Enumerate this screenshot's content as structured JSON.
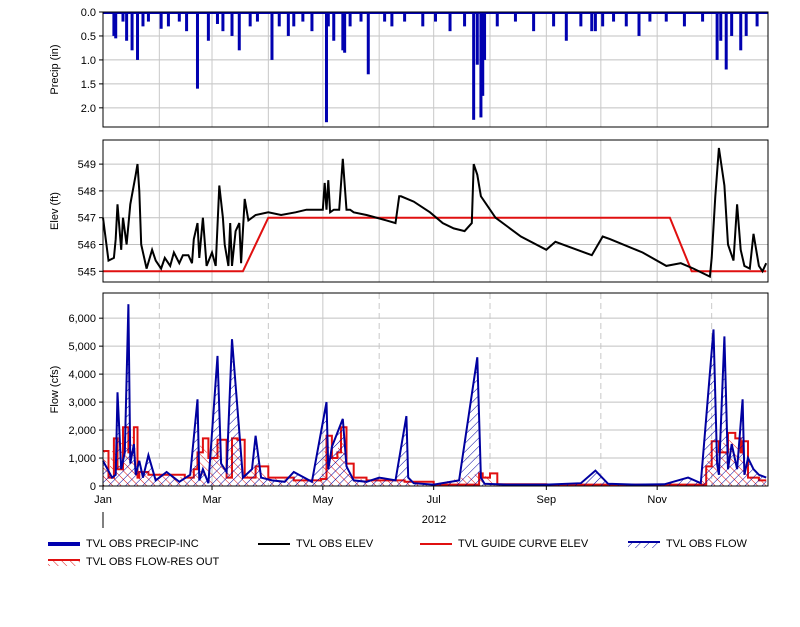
{
  "colors": {
    "precip": "#0000b0",
    "elev": "#000000",
    "guide": "#e01010",
    "flow": "#0000a0",
    "resout": "#e01010",
    "grid": "#c0c0c0",
    "month_grid": "#c8c8c8"
  },
  "x_axis": {
    "year_label": "2012",
    "month_labels": [
      "Jan",
      "Mar",
      "May",
      "Jul",
      "Sep",
      "Nov"
    ],
    "range_days": [
      0,
      366
    ]
  },
  "legend": {
    "items": [
      {
        "label": "TVL OBS PRECIP-INC",
        "icon": "thick-blue-line"
      },
      {
        "label": "TVL OBS ELEV",
        "icon": "black-line"
      },
      {
        "label": "TVL GUIDE CURVE ELEV",
        "icon": "red-line"
      },
      {
        "label": "TVL OBS FLOW",
        "icon": "blue-hatched-area"
      },
      {
        "label": "TVL OBS FLOW-RES OUT",
        "icon": "red-hatched-area"
      }
    ]
  },
  "chart_data": [
    {
      "type": "bar",
      "ylabel": "Precip (in)",
      "ylim": [
        0,
        2.4
      ],
      "y_inverted": true,
      "y_ticks": [
        "0.0",
        "0.5",
        "1.0",
        "1.5",
        "2.0"
      ],
      "series": [
        {
          "name": "TVL OBS PRECIP-INC",
          "x": [
            "2012-01-07",
            "2012-01-08",
            "2012-01-12",
            "2012-01-14",
            "2012-01-17",
            "2012-01-20",
            "2012-01-23",
            "2012-01-26",
            "2012-02-02",
            "2012-02-06",
            "2012-02-12",
            "2012-02-16",
            "2012-02-22",
            "2012-02-28",
            "2012-03-04",
            "2012-03-07",
            "2012-03-12",
            "2012-03-16",
            "2012-03-22",
            "2012-03-26",
            "2012-04-03",
            "2012-04-07",
            "2012-04-12",
            "2012-04-15",
            "2012-04-20",
            "2012-04-25",
            "2012-05-03",
            "2012-05-04",
            "2012-05-07",
            "2012-05-12",
            "2012-05-13",
            "2012-05-16",
            "2012-05-22",
            "2012-05-26",
            "2012-06-04",
            "2012-06-08",
            "2012-06-15",
            "2012-06-25",
            "2012-07-02",
            "2012-07-10",
            "2012-07-18",
            "2012-07-23",
            "2012-07-25",
            "2012-07-27",
            "2012-07-28",
            "2012-07-29",
            "2012-08-05",
            "2012-08-15",
            "2012-08-25",
            "2012-09-05",
            "2012-09-12",
            "2012-09-20",
            "2012-09-26",
            "2012-09-28",
            "2012-10-02",
            "2012-10-08",
            "2012-10-15",
            "2012-10-22",
            "2012-10-28",
            "2012-11-06",
            "2012-11-16",
            "2012-11-26",
            "2012-12-04",
            "2012-12-06",
            "2012-12-09",
            "2012-12-12",
            "2012-12-17",
            "2012-12-20",
            "2012-12-26"
          ],
          "values": [
            0.5,
            0.55,
            0.2,
            0.6,
            0.8,
            1.0,
            0.3,
            0.2,
            0.35,
            0.3,
            0.2,
            0.4,
            1.6,
            0.6,
            0.25,
            0.4,
            0.5,
            0.8,
            0.3,
            0.2,
            1.0,
            0.3,
            0.5,
            0.3,
            0.2,
            0.4,
            2.3,
            0.3,
            0.6,
            0.8,
            0.85,
            0.3,
            0.2,
            1.3,
            0.2,
            0.3,
            0.2,
            0.3,
            0.2,
            0.4,
            0.3,
            2.25,
            1.1,
            2.2,
            1.75,
            1.0,
            0.3,
            0.2,
            0.4,
            0.3,
            0.6,
            0.3,
            0.4,
            0.4,
            0.3,
            0.2,
            0.3,
            0.5,
            0.2,
            0.2,
            0.3,
            0.2,
            1.0,
            0.6,
            1.2,
            0.5,
            0.8,
            0.5,
            0.3
          ]
        }
      ]
    },
    {
      "type": "line",
      "ylabel": "Elev (ft)",
      "ylim": [
        544.6,
        549.9
      ],
      "y_ticks": [
        "545",
        "546",
        "547",
        "548",
        "549"
      ],
      "series": [
        {
          "name": "TVL OBS ELEV",
          "x": [
            "2012-01-01",
            "2012-01-04",
            "2012-01-07",
            "2012-01-08",
            "2012-01-09",
            "2012-01-11",
            "2012-01-12",
            "2012-01-14",
            "2012-01-16",
            "2012-01-19",
            "2012-01-20",
            "2012-01-21",
            "2012-01-22",
            "2012-01-25",
            "2012-01-28",
            "2012-01-30",
            "2012-02-02",
            "2012-02-04",
            "2012-02-07",
            "2012-02-09",
            "2012-02-12",
            "2012-02-14",
            "2012-02-17",
            "2012-02-19",
            "2012-02-20",
            "2012-02-22",
            "2012-02-23",
            "2012-02-25",
            "2012-02-27",
            "2012-03-01",
            "2012-03-03",
            "2012-03-05",
            "2012-03-07",
            "2012-03-08",
            "2012-03-10",
            "2012-03-11",
            "2012-03-12",
            "2012-03-14",
            "2012-03-16",
            "2012-03-17",
            "2012-03-19",
            "2012-03-21",
            "2012-03-25",
            "2012-04-01",
            "2012-04-08",
            "2012-04-16",
            "2012-04-22",
            "2012-05-01",
            "2012-05-02",
            "2012-05-03",
            "2012-05-04",
            "2012-05-05",
            "2012-05-07",
            "2012-05-10",
            "2012-05-12",
            "2012-05-14",
            "2012-05-16",
            "2012-05-18",
            "2012-05-25",
            "2012-06-05",
            "2012-06-10",
            "2012-06-12",
            "2012-06-13",
            "2012-06-20",
            "2012-06-29",
            "2012-07-06",
            "2012-07-12",
            "2012-07-18",
            "2012-07-22",
            "2012-07-23",
            "2012-07-25",
            "2012-07-27",
            "2012-08-04",
            "2012-08-18",
            "2012-09-01",
            "2012-09-06",
            "2012-09-14",
            "2012-09-26",
            "2012-10-02",
            "2012-10-06",
            "2012-10-24",
            "2012-11-06",
            "2012-11-14",
            "2012-11-21",
            "2012-11-30",
            "2012-12-01",
            "2012-12-03",
            "2012-12-05",
            "2012-12-08",
            "2012-12-10",
            "2012-12-13",
            "2012-12-15",
            "2012-12-17",
            "2012-12-19",
            "2012-12-22",
            "2012-12-24",
            "2012-12-27",
            "2012-12-29",
            "2012-12-31"
          ],
          "values": [
            547.0,
            545.4,
            545.5,
            546.2,
            547.5,
            545.8,
            547.0,
            546.0,
            547.5,
            548.6,
            549.0,
            548.0,
            546.0,
            545.1,
            545.8,
            545.4,
            545.1,
            545.5,
            545.2,
            545.7,
            545.3,
            545.6,
            545.6,
            545.3,
            546.2,
            546.8,
            545.5,
            547.0,
            545.2,
            545.7,
            545.2,
            548.2,
            547.0,
            546.0,
            545.2,
            546.8,
            545.2,
            546.5,
            546.8,
            545.3,
            547.7,
            546.9,
            547.1,
            547.2,
            547.1,
            547.2,
            547.3,
            547.3,
            548.3,
            547.3,
            548.4,
            547.2,
            547.3,
            547.3,
            549.2,
            547.3,
            547.3,
            547.2,
            547.1,
            546.9,
            546.8,
            547.8,
            547.8,
            547.6,
            547.2,
            546.8,
            546.6,
            546.5,
            546.8,
            549.0,
            548.6,
            547.8,
            547.0,
            546.3,
            545.8,
            546.1,
            545.9,
            545.6,
            546.3,
            546.2,
            545.7,
            545.2,
            545.3,
            545.1,
            544.8,
            545.5,
            547.8,
            549.6,
            548.2,
            546.0,
            545.4,
            547.5,
            545.8,
            545.2,
            545.1,
            546.4,
            545.2,
            545.0,
            545.3
          ]
        },
        {
          "name": "TVL GUIDE CURVE ELEV",
          "x": [
            "2012-01-01",
            "2012-03-18",
            "2012-04-01",
            "2012-04-06",
            "2012-11-08",
            "2012-11-20",
            "2012-12-31"
          ],
          "values": [
            545.0,
            545.0,
            547.0,
            547.0,
            547.0,
            545.0,
            545.0
          ]
        }
      ]
    },
    {
      "type": "area",
      "ylabel": "Flow (cfs)",
      "ylim": [
        0,
        6900
      ],
      "y_ticks": [
        "0",
        "1,000",
        "2,000",
        "3,000",
        "4,000",
        "5,000",
        "6,000"
      ],
      "series": [
        {
          "name": "TVL OBS FLOW",
          "x": [
            "2012-01-01",
            "2012-01-06",
            "2012-01-08",
            "2012-01-09",
            "2012-01-11",
            "2012-01-13",
            "2012-01-15",
            "2012-01-16",
            "2012-01-18",
            "2012-01-19",
            "2012-01-21",
            "2012-01-23",
            "2012-01-26",
            "2012-01-30",
            "2012-02-05",
            "2012-02-12",
            "2012-02-18",
            "2012-02-22",
            "2012-02-23",
            "2012-02-25",
            "2012-02-28",
            "2012-03-04",
            "2012-03-06",
            "2012-03-09",
            "2012-03-12",
            "2012-03-18",
            "2012-03-23",
            "2012-03-25",
            "2012-03-28",
            "2012-04-03",
            "2012-04-10",
            "2012-04-15",
            "2012-04-25",
            "2012-05-03",
            "2012-05-04",
            "2012-05-06",
            "2012-05-12",
            "2012-05-14",
            "2012-05-18",
            "2012-05-25",
            "2012-06-01",
            "2012-06-10",
            "2012-06-16",
            "2012-06-17",
            "2012-06-20",
            "2012-07-01",
            "2012-07-15",
            "2012-07-25",
            "2012-07-27",
            "2012-07-29",
            "2012-08-10",
            "2012-09-01",
            "2012-09-20",
            "2012-09-28",
            "2012-10-05",
            "2012-10-20",
            "2012-11-05",
            "2012-11-18",
            "2012-11-25",
            "2012-12-02",
            "2012-12-04",
            "2012-12-05",
            "2012-12-08",
            "2012-12-10",
            "2012-12-12",
            "2012-12-15",
            "2012-12-18",
            "2012-12-19",
            "2012-12-21",
            "2012-12-24",
            "2012-12-27",
            "2012-12-31"
          ],
          "values": [
            900,
            300,
            400,
            3350,
            600,
            1200,
            6500,
            800,
            1500,
            400,
            900,
            300,
            1100,
            200,
            500,
            150,
            400,
            3100,
            200,
            600,
            100,
            4650,
            800,
            500,
            5250,
            300,
            600,
            1800,
            300,
            200,
            150,
            500,
            150,
            3000,
            600,
            1400,
            2400,
            700,
            200,
            150,
            300,
            200,
            2500,
            300,
            100,
            50,
            200,
            4600,
            300,
            80,
            50,
            50,
            100,
            550,
            80,
            50,
            60,
            300,
            100,
            5600,
            800,
            400,
            5350,
            600,
            1500,
            600,
            3100,
            400,
            1000,
            600,
            400,
            300
          ]
        },
        {
          "name": "TVL OBS FLOW-RES OUT",
          "x": [
            "2012-01-01",
            "2012-01-02",
            "2012-01-04",
            "2012-01-07",
            "2012-01-09",
            "2012-01-12",
            "2012-01-15",
            "2012-01-18",
            "2012-01-20",
            "2012-01-21",
            "2012-01-26",
            "2012-02-01",
            "2012-02-15",
            "2012-02-20",
            "2012-02-22",
            "2012-02-25",
            "2012-02-28",
            "2012-03-04",
            "2012-03-09",
            "2012-03-12",
            "2012-03-15",
            "2012-03-19",
            "2012-03-25",
            "2012-04-01",
            "2012-04-15",
            "2012-04-30",
            "2012-05-03",
            "2012-05-06",
            "2012-05-09",
            "2012-05-11",
            "2012-05-14",
            "2012-05-18",
            "2012-05-25",
            "2012-06-15",
            "2012-07-01",
            "2012-07-26",
            "2012-07-28",
            "2012-08-01",
            "2012-08-05",
            "2012-09-01",
            "2012-10-01",
            "2012-11-01",
            "2012-11-25",
            "2012-11-28",
            "2012-12-01",
            "2012-12-05",
            "2012-12-10",
            "2012-12-14",
            "2012-12-17",
            "2012-12-18",
            "2012-12-21",
            "2012-12-27",
            "2012-12-31"
          ],
          "values": [
            1250,
            1250,
            300,
            1700,
            600,
            2100,
            1200,
            2100,
            300,
            500,
            400,
            400,
            300,
            600,
            1200,
            1700,
            1000,
            1650,
            300,
            1700,
            1650,
            300,
            700,
            300,
            200,
            250,
            1800,
            1000,
            1200,
            2100,
            800,
            300,
            200,
            150,
            50,
            450,
            300,
            450,
            60,
            50,
            50,
            50,
            50,
            700,
            1600,
            1200,
            1900,
            1700,
            1200,
            1600,
            300,
            200,
            200
          ]
        }
      ]
    }
  ]
}
